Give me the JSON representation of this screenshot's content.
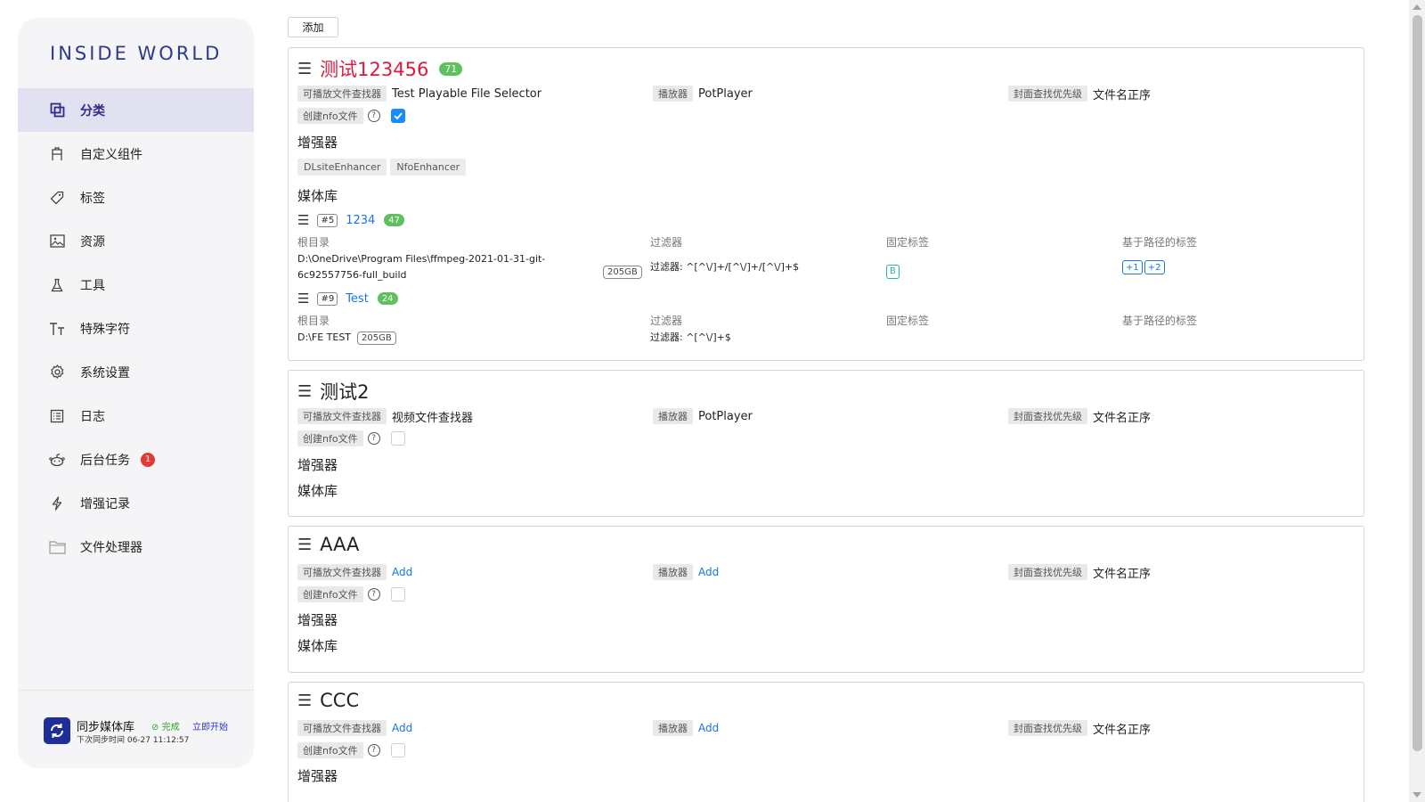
{
  "sidebar": {
    "logo": "INSIDE WORLD",
    "items": [
      {
        "label": "分类",
        "icon": "copy-icon"
      },
      {
        "label": "自定义组件",
        "icon": "component-icon"
      },
      {
        "label": "标签",
        "icon": "tag-icon"
      },
      {
        "label": "资源",
        "icon": "image-icon"
      },
      {
        "label": "工具",
        "icon": "flask-icon"
      },
      {
        "label": "特殊字符",
        "icon": "text-size-icon"
      },
      {
        "label": "系统设置",
        "icon": "gear-icon"
      },
      {
        "label": "日志",
        "icon": "log-icon"
      },
      {
        "label": "后台任务",
        "icon": "robot-icon",
        "badge": "1"
      },
      {
        "label": "增强记录",
        "icon": "bolt-icon"
      },
      {
        "label": "文件处理器",
        "icon": "folder-icon"
      }
    ],
    "sync": {
      "title": "同步媒体库",
      "status": "完成",
      "start": "立即开始",
      "next": "下次同步时间 06-27 11:12:57"
    }
  },
  "toolbar": {
    "add_label": "添加"
  },
  "labels": {
    "finder": "可播放文件查找器",
    "player": "播放器",
    "cover": "封面查找优先级",
    "nfo": "创建nfo文件",
    "enhancer": "增强器",
    "library": "媒体库",
    "root": "根目录",
    "filter": "过滤器",
    "fixed_tags": "固定标签",
    "path_tags": "基于路径的标签",
    "help": "?"
  },
  "categories": [
    {
      "title": "测试123456",
      "count": "71",
      "finder": "Test Playable File Selector",
      "player": "PotPlayer",
      "cover": "文件名正序",
      "nfo_checked": true,
      "enhancers": [
        "DLsiteEnhancer",
        "NfoEnhancer"
      ],
      "libraries": [
        {
          "id": "#5",
          "name": "1234",
          "count": "47",
          "root_line1": "D:\\OneDrive\\Program Files\\ffmpeg-2021-01-31-git-",
          "root_line2": "6c92557756-full_build",
          "size": "205GB",
          "filter": "过滤器: ^[^\\/]+/[^\\/]+/[^\\/]+$",
          "fixed_tag": "B",
          "path_tags": [
            "+1",
            "+2"
          ]
        },
        {
          "id": "#9",
          "name": "Test",
          "count": "24",
          "root": "D:\\FE TEST",
          "size": "205GB",
          "filter": "过滤器: ^[^\\/]+$"
        }
      ]
    },
    {
      "title": "测试2",
      "finder": "视频文件查找器",
      "player": "PotPlayer",
      "cover": "文件名正序",
      "nfo_checked": false
    },
    {
      "title": "AAA",
      "finder": "Add",
      "player": "Add",
      "cover": "文件名正序",
      "nfo_checked": false
    },
    {
      "title": "CCC",
      "finder": "Add",
      "player": "Add",
      "cover": "文件名正序",
      "nfo_checked": false
    }
  ],
  "colors": {
    "accent": "#2d2a8c",
    "link": "#1a73e8",
    "count_green": "#5ec05e",
    "title_red": "#e0183c"
  }
}
